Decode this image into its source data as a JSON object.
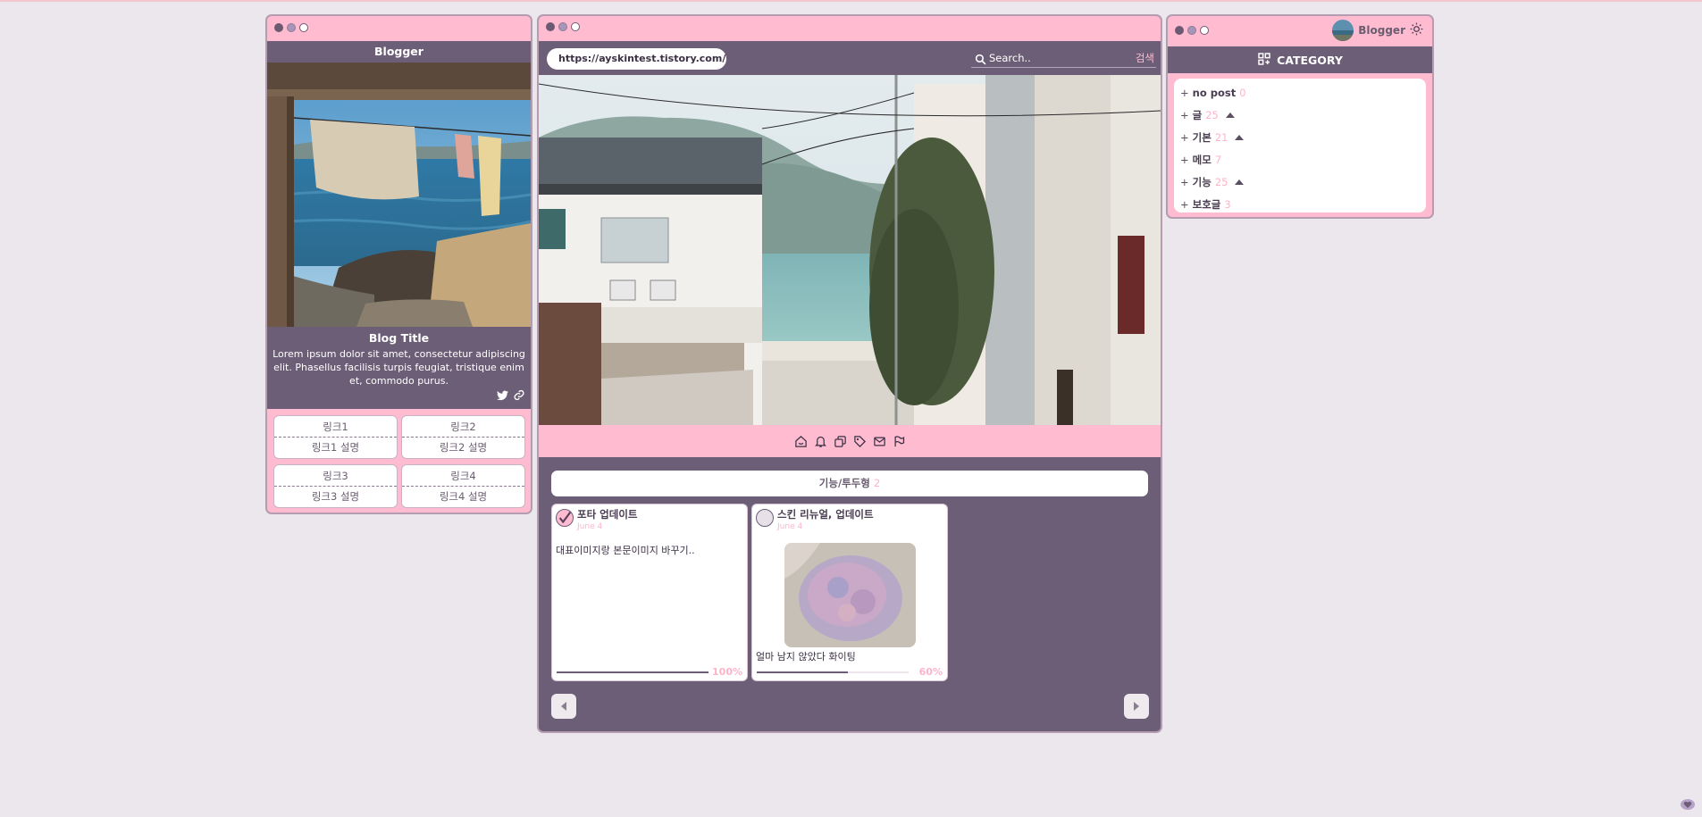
{
  "profile_window": {
    "header": "Blogger",
    "blog_title": "Blog Title",
    "description": "Lorem ipsum dolor sit amet, consectetur adipiscing elit. Phasellus facilisis turpis feugiat, tristique enim et, commodo purus.",
    "icons": [
      "twitter-icon",
      "link-icon"
    ],
    "links": [
      {
        "label": "링크1",
        "desc": "링크1 설명"
      },
      {
        "label": "링크2",
        "desc": "링크2 설명"
      },
      {
        "label": "링크3",
        "desc": "링크3 설명"
      },
      {
        "label": "링크4",
        "desc": "링크4 설명"
      }
    ]
  },
  "main_window": {
    "url": "https://ayskintest.tistory.com/",
    "search_placeholder": "Search..",
    "search_button": "검색",
    "toolbar_icons": [
      "home-icon",
      "bell-icon",
      "copy-icon",
      "tag-icon",
      "mail-icon",
      "flag-icon"
    ],
    "category": {
      "name": "기능/투두형",
      "count": "2"
    },
    "cards": [
      {
        "title": "포타 업데이트",
        "date": "June 4",
        "text": "대표이미지랑 본문이미지 바꾸기..",
        "progress": 100,
        "progress_label": "100%",
        "checked": true
      },
      {
        "title": "스킨 리뉴얼, 업데이트",
        "date": "June 4",
        "text": "얼마 남지 않았다 화이팅",
        "progress": 60,
        "progress_label": "60%",
        "checked": false
      }
    ]
  },
  "category_window": {
    "user_name": "Blogger",
    "title": "CATEGORY",
    "items": [
      {
        "name": "no post",
        "count": "0",
        "expandable": false
      },
      {
        "name": "글",
        "count": "25",
        "expandable": true
      },
      {
        "name": "기본",
        "count": "21",
        "expandable": true
      },
      {
        "name": "메모",
        "count": "7",
        "expandable": false
      },
      {
        "name": "기능",
        "count": "25",
        "expandable": true
      },
      {
        "name": "보호글",
        "count": "3",
        "expandable": false
      }
    ]
  },
  "colors": {
    "pink": "#ffbcd1",
    "purple": "#6d5e77",
    "background": "#ece7ec",
    "accent_text": "#ffb3c9"
  }
}
